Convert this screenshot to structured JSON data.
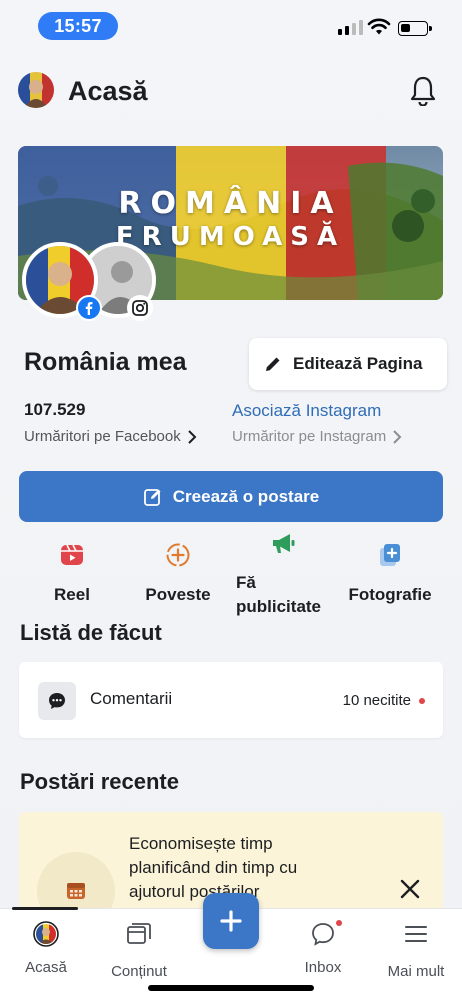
{
  "status_bar": {
    "time": "15:57"
  },
  "header": {
    "title": "Acasă"
  },
  "cover": {
    "line1": "ROMÂNIA",
    "line2": "FRUMOASĂ"
  },
  "page": {
    "name": "România mea",
    "edit_label": "Editează Pagina",
    "fb_followers": "107.529",
    "fb_followers_label": "Urmăritori pe Facebook",
    "ig_link": "Asociază Instagram",
    "ig_followers_label": "Urmăritor pe Instagram"
  },
  "create_post": {
    "label": "Creează o postare"
  },
  "actions": [
    {
      "label": "Reel",
      "icon": "reel-icon",
      "color": "#e0454b"
    },
    {
      "label": "Poveste",
      "icon": "story-plus-icon",
      "color": "#e07a2e"
    },
    {
      "label_line1": "Fă",
      "label_line2": "publicitate",
      "icon": "megaphone-icon",
      "color": "#2e9c5a"
    },
    {
      "label": "Fotografie",
      "icon": "photo-plus-icon",
      "color": "#4a8fd6"
    }
  ],
  "todo": {
    "title": "Listă de făcut",
    "items": [
      {
        "label": "Comentarii",
        "status": "10 necitite",
        "icon": "comment-icon"
      }
    ]
  },
  "recent": {
    "title": "Postări recente",
    "promo_line1": "Economisește timp",
    "promo_line2": "planificând din timp cu",
    "promo_line3": "ajutorul postărilor"
  },
  "bottom_nav": {
    "items": [
      {
        "label": "Acasă",
        "icon": "home-avatar-icon"
      },
      {
        "label": "Conținut",
        "icon": "content-icon"
      },
      {
        "label": "Inbox",
        "icon": "inbox-icon"
      },
      {
        "label": "Mai mult",
        "icon": "menu-icon"
      }
    ]
  },
  "colors": {
    "accent": "#3b77c6",
    "link": "#2f6db7",
    "badge_red": "#e0454b",
    "promo_bg": "#fbf4d8"
  }
}
